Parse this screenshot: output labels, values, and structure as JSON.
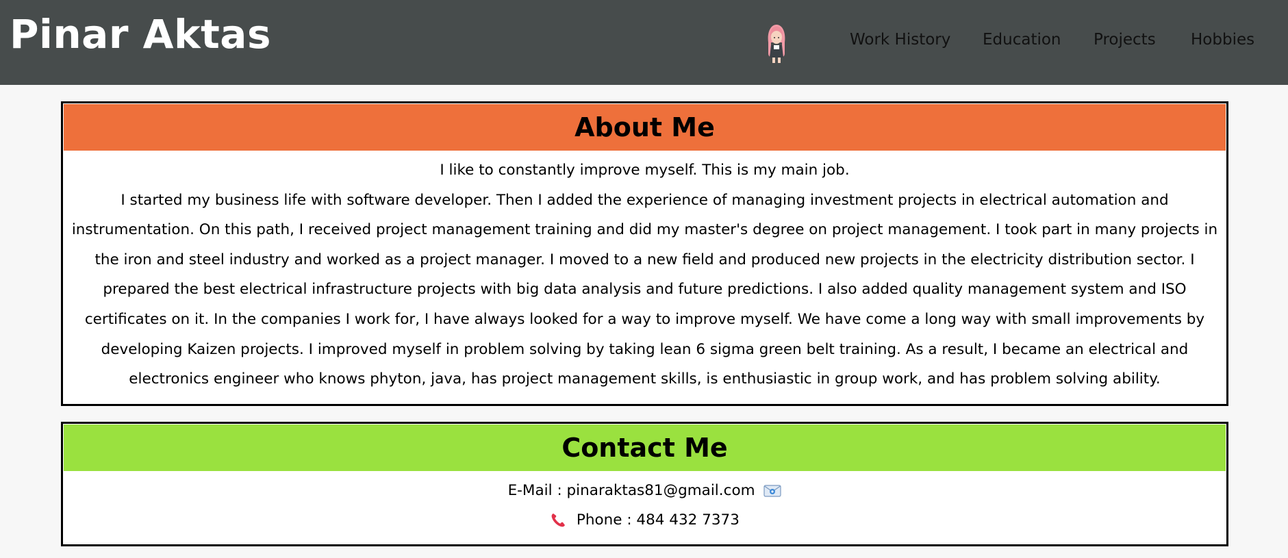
{
  "header": {
    "name": "Pinar Aktas",
    "avatar_icon": "girl-avatar-icon",
    "nav": [
      {
        "label": "Work History"
      },
      {
        "label": "Education"
      },
      {
        "label": "Projects"
      },
      {
        "label": "Hobbies"
      }
    ],
    "colors": {
      "bar": "#474c4c",
      "name": "#ffffff"
    }
  },
  "about": {
    "title": "About Me",
    "color": "#ee703b",
    "intro": "I like to constantly improve myself. This is my main job.",
    "text": "I started my business life with software developer. Then I added the experience of managing investment projects in electrical automation and instrumentation. On this path, I received project management training and did my master's degree on project management. I took part in many projects in the iron and steel industry and worked as a project manager. I moved to a new field and produced new projects in the electricity distribution sector. I prepared the best electrical infrastructure projects with big data analysis and future predictions. I also added quality management system and ISO certificates on it. In the companies I work for, I have always looked for a way to improve myself. We have come a long way with small improvements by developing Kaizen projects. I improved myself in problem solving by taking lean 6 sigma green belt training. As a result, I became an electrical and electronics engineer who knows phyton, java, has project management skills, is enthusiastic in group work, and has problem solving ability."
  },
  "contact": {
    "title": "Contact Me",
    "color": "#9ae13f",
    "email_text": "E-Mail : pinaraktas81@gmail.com",
    "email_icon": "envelope-icon",
    "phone_text": "Phone : 484 432 7373",
    "phone_icon": "telephone-receiver-icon"
  }
}
